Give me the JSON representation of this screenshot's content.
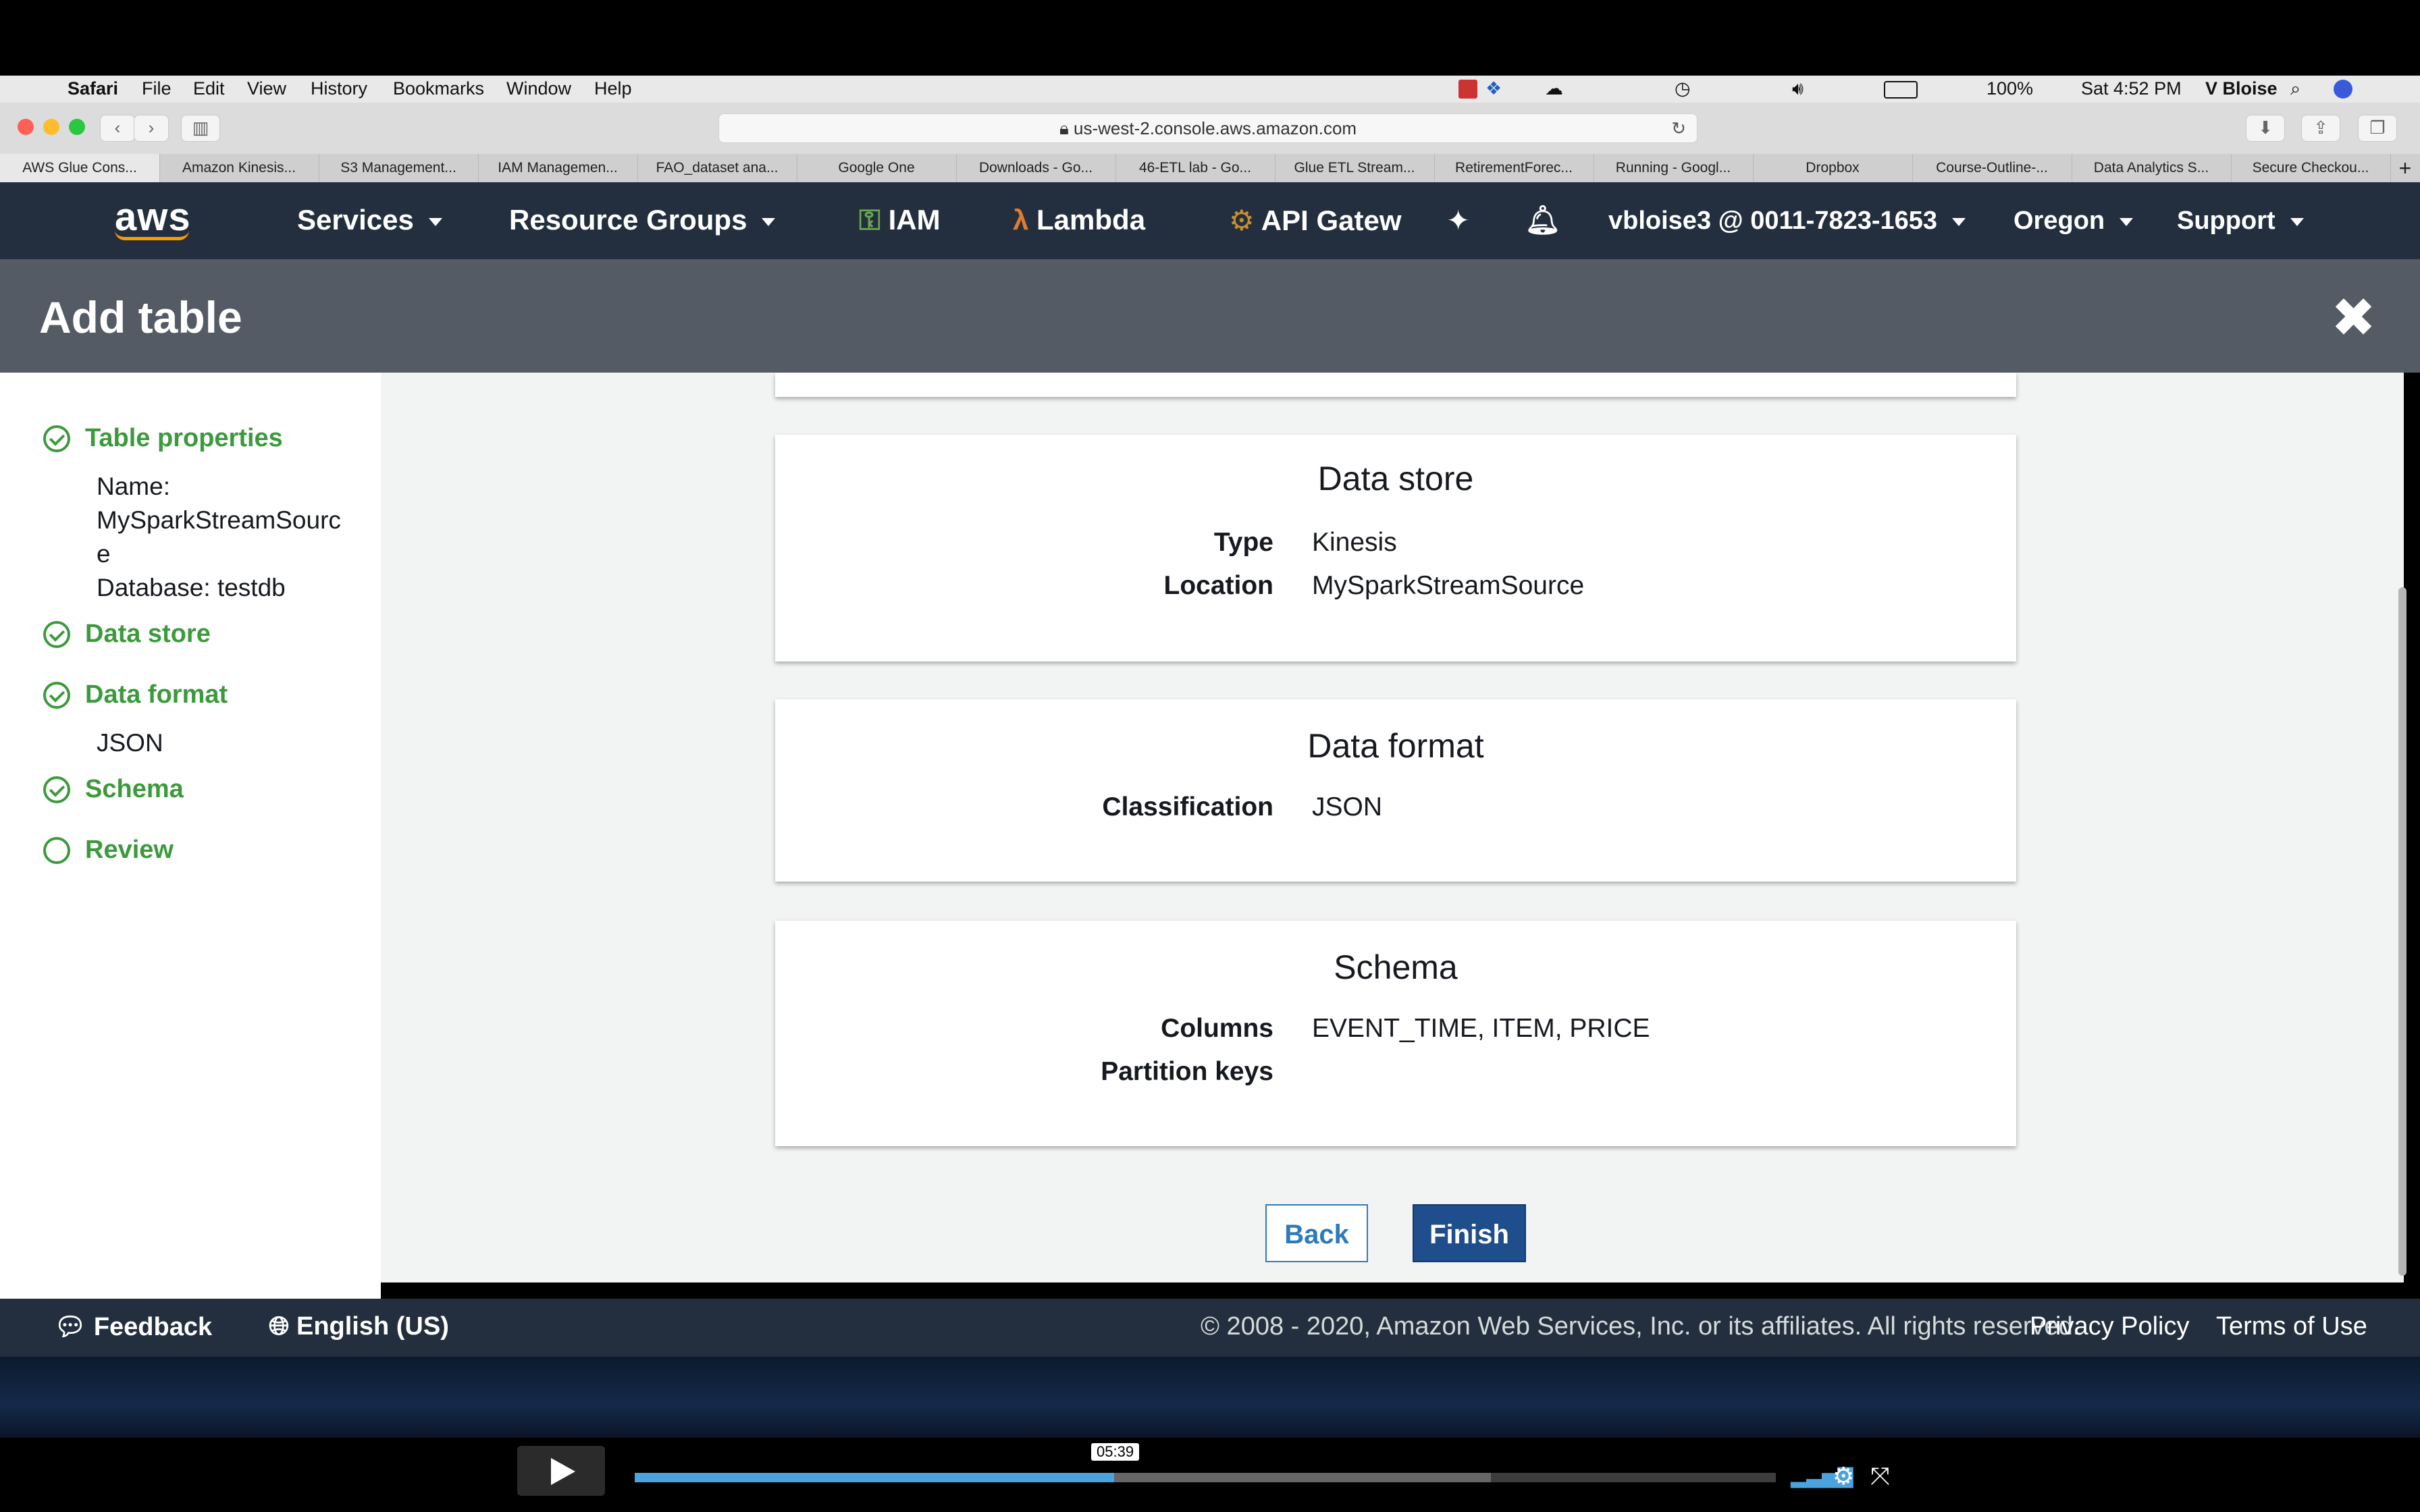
{
  "menubar": {
    "app": "Safari",
    "items": [
      "File",
      "Edit",
      "View",
      "History",
      "Bookmarks",
      "Window",
      "Help"
    ],
    "battery": "100%",
    "clock": "Sat 4:52 PM",
    "user": "V Bloise"
  },
  "browser": {
    "url": "us-west-2.console.aws.amazon.com",
    "tabs": [
      {
        "label": "AWS Glue Cons..."
      },
      {
        "label": "Amazon Kinesis..."
      },
      {
        "label": "S3 Management..."
      },
      {
        "label": "IAM Managemen..."
      },
      {
        "label": "FAO_dataset ana..."
      },
      {
        "label": "Google One"
      },
      {
        "label": "Downloads - Go..."
      },
      {
        "label": "46-ETL lab - Go..."
      },
      {
        "label": "Glue ETL Stream..."
      },
      {
        "label": "RetirementForec..."
      },
      {
        "label": "Running - Googl..."
      },
      {
        "label": "Dropbox"
      },
      {
        "label": "Course-Outline-..."
      },
      {
        "label": "Data Analytics S..."
      },
      {
        "label": "Secure Checkou..."
      }
    ]
  },
  "aws_nav": {
    "logo": "aws",
    "services": "Services",
    "resource_groups": "Resource Groups",
    "iam": "IAM",
    "lambda": "Lambda",
    "api_gateway": "API Gatew",
    "account": "vbloise3 @ 0011-7823-1653",
    "region": "Oregon",
    "support": "Support"
  },
  "modal": {
    "title": "Add table",
    "steps": {
      "table_properties": {
        "label": "Table properties",
        "name_line1": "Name:",
        "name_line2": "MySparkStreamSourc",
        "name_line3": "e",
        "database": "Database: testdb"
      },
      "data_store": {
        "label": "Data store"
      },
      "data_format": {
        "label": "Data format",
        "value": "JSON"
      },
      "schema": {
        "label": "Schema"
      },
      "review": {
        "label": "Review"
      }
    },
    "data_store_card": {
      "title": "Data store",
      "type_label": "Type",
      "type_value": "Kinesis",
      "location_label": "Location",
      "location_value": "MySparkStreamSource"
    },
    "data_format_card": {
      "title": "Data format",
      "classification_label": "Classification",
      "classification_value": "JSON"
    },
    "schema_card": {
      "title": "Schema",
      "columns_label": "Columns",
      "columns_value": "EVENT_TIME, ITEM, PRICE",
      "partition_label": "Partition keys"
    },
    "back_label": "Back",
    "finish_label": "Finish"
  },
  "footer": {
    "feedback": "Feedback",
    "language": "English (US)",
    "copyright": "© 2008 - 2020, Amazon Web Services, Inc. or its affiliates. All rights reserved.",
    "privacy": "Privacy Policy",
    "terms": "Terms of Use"
  },
  "player": {
    "time": "05:39",
    "played_fraction": 0.42,
    "loaded_fraction": 0.75
  },
  "colors": {
    "aws_navy": "#232f3e",
    "modal_header": "#545b64",
    "step_green": "#3c9a3c",
    "finish_blue": "#1f4e8c",
    "back_blue": "#2d7bb8"
  }
}
